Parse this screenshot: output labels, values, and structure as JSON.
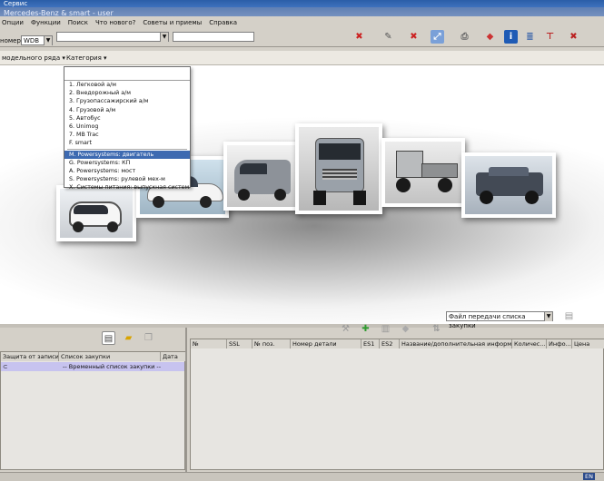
{
  "top_menu": [
    "Сервис",
    "",
    ""
  ],
  "title": "Mercedes-Benz & smart - user",
  "menu": [
    "Опции",
    "Функции",
    "Поиск",
    "Что нового?",
    "Советы и приемы",
    "Справка"
  ],
  "toolbar": {
    "prefix_label": "номер",
    "prefix_value": "WDB",
    "vin_value": "",
    "search_value": ""
  },
  "filterbar": {
    "model_label": "модельного ряда ▾",
    "category_label": "Категория ▾"
  },
  "category_dropdown": {
    "items": [
      "1. Легковой а/м",
      "2. Внедорожный а/м",
      "3. Грузопассажирский а/м",
      "4. Грузовой а/м",
      "5. Автобус",
      "6. Unimog",
      "7. MB Trac",
      "F. smart",
      "M. Powersystems: двигатель",
      "G. Powersystems: КП",
      "A. Powersystems: мост",
      "S. Powersystems: рулевой мех-м",
      "X. Системы питания: выпускная система"
    ],
    "selected_index": 8
  },
  "left_panel": {
    "columns": [
      "Защита от записи",
      "Список закупки",
      "Дата"
    ],
    "rows": [
      {
        "lock": "",
        "list": "-- Временный список закупки --",
        "date": ""
      }
    ]
  },
  "right_panel": {
    "file_select": "Файл передачи списка закупки",
    "columns": [
      "№",
      "SSL",
      "№ поз.",
      "Номер детали",
      "ES1",
      "ES2",
      "Название/дополнительная информ...",
      "Количес...",
      "Инфо...",
      "Цена"
    ]
  },
  "status": {
    "lang": "EN"
  },
  "colors": {
    "selection": "#3d6ab1",
    "titlebar": "#5f7fb3",
    "row_highlight": "#c7c3ef"
  }
}
